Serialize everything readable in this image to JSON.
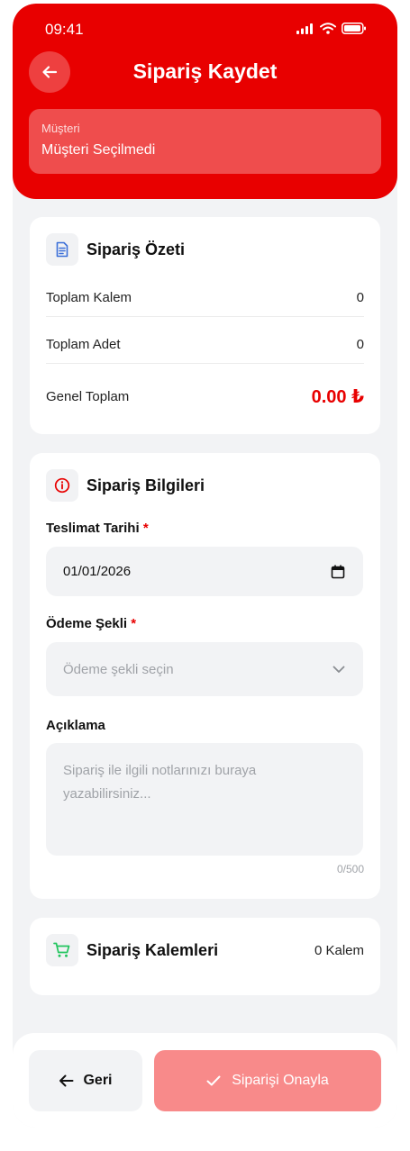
{
  "status": {
    "time": "09:41"
  },
  "header": {
    "title": "Sipariş Kaydet",
    "customer_label": "Müşteri",
    "customer_value": "Müşteri Seçilmedi"
  },
  "summary": {
    "title": "Sipariş Özeti",
    "rows": [
      {
        "label": "Toplam Kalem",
        "value": "0"
      },
      {
        "label": "Toplam Adet",
        "value": "0"
      }
    ],
    "total_label": "Genel Toplam",
    "total_value": "0.00 ₺"
  },
  "info": {
    "title": "Sipariş Bilgileri",
    "delivery_label": "Teslimat Tarihi",
    "delivery_value": "01/01/2026",
    "payment_label": "Ödeme Şekli",
    "payment_placeholder": "Ödeme şekli seçin",
    "note_label": "Açıklama",
    "note_placeholder": "Sipariş ile ilgili notlarınızı buraya yazabilirsiniz...",
    "note_counter": "0/500",
    "required_mark": "*"
  },
  "items": {
    "title": "Sipariş Kalemleri",
    "count": "0 Kalem"
  },
  "actions": {
    "back_label": "Geri",
    "confirm_label": "Siparişi Onayla"
  },
  "colors": {
    "brand": "#e80000",
    "confirm_disabled": "#f88a8a",
    "items_icon": "#22c55e",
    "summary_icon": "#3b6fd8"
  }
}
